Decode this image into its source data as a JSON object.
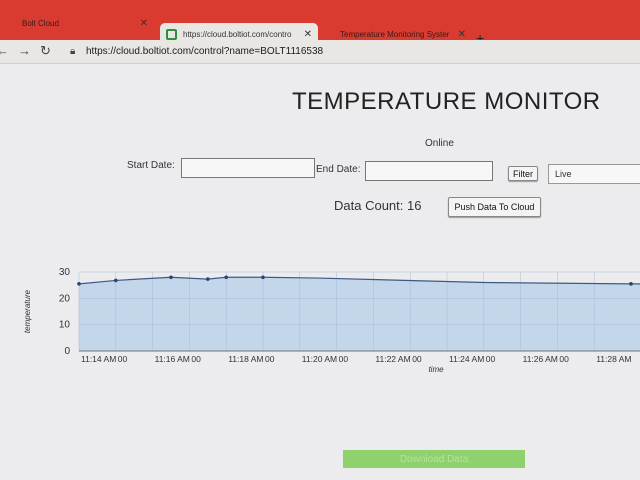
{
  "browser": {
    "tabs": [
      {
        "label": "Bolt Cloud"
      },
      {
        "label": "https://cloud.boltiot.com/contro"
      },
      {
        "label": "Temperature Monitoring Syster"
      }
    ],
    "url": "https://cloud.boltiot.com/control?name=BOLT1116538"
  },
  "page": {
    "title": "TEMPERATURE MONITOR",
    "status": "Online",
    "start_date_label": "Start Date:",
    "end_date_label": "End Date:",
    "filter_label": "Filter",
    "range_value": "Live",
    "data_count": "Data Count: 16",
    "push_label": "Push Data To Cloud",
    "download_label": "Download Data"
  },
  "chart_data": {
    "type": "area",
    "ylabel": "temperature",
    "xlabel": "time",
    "ylim": [
      0,
      30
    ],
    "y_ticks": [
      0,
      10,
      20,
      30
    ],
    "x_tick_labels": [
      "11:14 AM",
      "00",
      "11:16 AM",
      "00",
      "11:18 AM",
      "00",
      "11:20 AM",
      "00",
      "11:22 AM",
      "00",
      "11:24 AM",
      "00",
      "11:26 AM",
      "00",
      "11:28 AM"
    ],
    "x_minutes": [
      0.0,
      0.5,
      1.25,
      1.75,
      2.0,
      2.5,
      3.25,
      5.5,
      7.5,
      7.9,
      10.8,
      15.3
    ],
    "y": [
      25.5,
      26.8,
      28.0,
      27.3,
      28.0,
      28.0,
      27.7,
      26.0,
      25.5,
      25.5,
      25.8,
      25.8
    ],
    "points_marked": [
      true,
      true,
      true,
      true,
      true,
      true,
      false,
      false,
      true,
      true,
      true,
      false
    ],
    "grid": true,
    "fill_color": "#c3d6ea",
    "line_color": "#3b5b85"
  }
}
